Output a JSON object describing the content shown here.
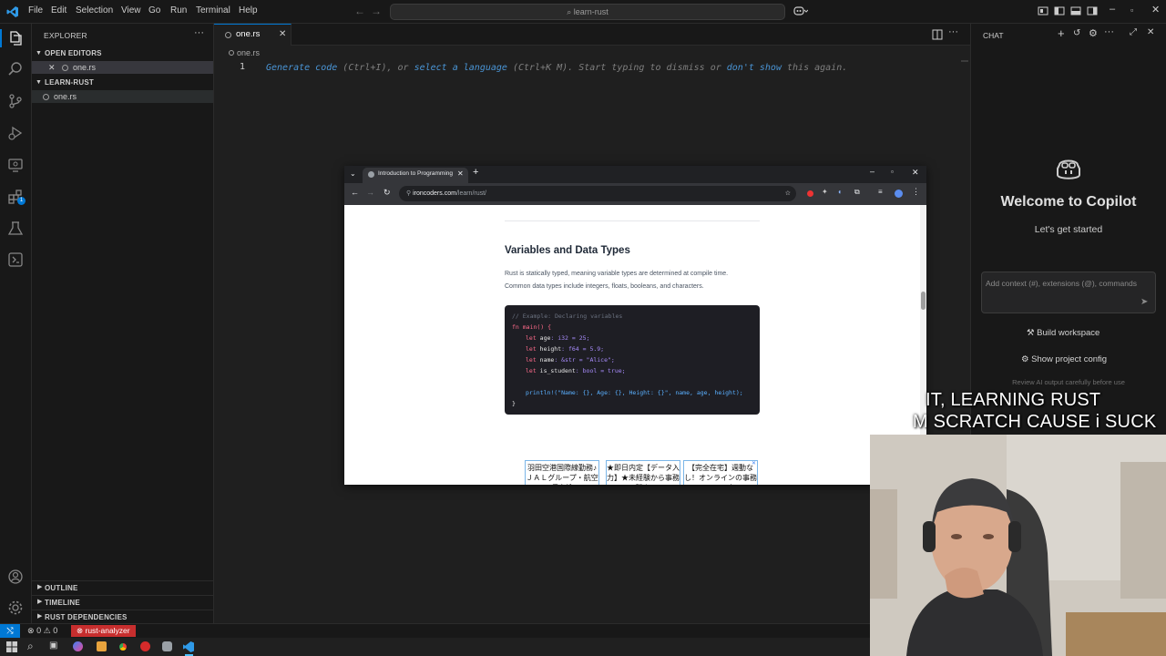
{
  "titlebar": {
    "menu": [
      "File",
      "Edit",
      "Selection",
      "View",
      "Go",
      "Run",
      "Terminal",
      "Help"
    ],
    "search": "learn-rust"
  },
  "sidebar": {
    "header": "EXPLORER",
    "open_editors_label": "OPEN EDITORS",
    "open_editor_file": "one.rs",
    "project_label": "LEARN-RUST",
    "project_file": "one.rs",
    "outline_label": "OUTLINE",
    "timeline_label": "TIMELINE",
    "rust_deps_label": "RUST DEPENDENCIES",
    "badge_count": "1"
  },
  "editor": {
    "tab_label": "one.rs",
    "breadcrumb": "one.rs",
    "line_number": "1",
    "hint_parts": {
      "link1": "Generate code",
      "text1": " (Ctrl+I), or ",
      "link2": "select a language",
      "text2": " (Ctrl+K M). Start typing to dismiss or ",
      "link3": "don't show",
      "text3": " this again."
    }
  },
  "chat": {
    "header": "CHAT",
    "welcome_title": "Welcome to Copilot",
    "subtitle": "Let's get started",
    "input_placeholder": "Add context (#), extensions (@), commands",
    "build_workspace": "Build workspace",
    "show_project_config": "Show project config",
    "review_note": "Review AI output carefully before use"
  },
  "statusbar": {
    "errors": "0",
    "warnings": "0",
    "rust_analyzer": "rust-analyzer"
  },
  "browser": {
    "tab_title": "Introduction to Programming",
    "url_domain": "ironcoders.com",
    "url_path": "/learn/rust/",
    "heading": "Variables and Data Types",
    "para_line1": "Rust is statically typed, meaning variable types are determined at compile time.",
    "para_line2": "Common data types include integers, floats, booleans, and characters.",
    "code": {
      "comment": "// Example: Declaring variables",
      "fn_line": "fn main() {",
      "l1": {
        "kw": "let ",
        "name": "age",
        "rest": ": i32 = 25;"
      },
      "l2": {
        "kw": "let ",
        "name": "height",
        "rest": ": f64 = 5.9;"
      },
      "l3": {
        "kw": "let ",
        "name": "name",
        "rest": ": &str = \"Alice\";"
      },
      "l4": {
        "kw": "let ",
        "name": "is_student",
        "rest": ": bool = true;"
      },
      "println": "println!(\"Name: {}, Age: {}, Height: {}\", name, age, height);",
      "close": "}"
    },
    "ads": [
      "羽田空港国際線勤務♪ＪＡＬグループ・航空保安検",
      "★即日内定【データ入力】★未経験から事務職を",
      "【完全在宅】週動なし！オンラインの事務アシスタ"
    ]
  },
  "overlay": {
    "caption_line1": "IT, LEARNING RUST",
    "caption_line2": "M SCRATCH CAUSE i SUCK"
  }
}
